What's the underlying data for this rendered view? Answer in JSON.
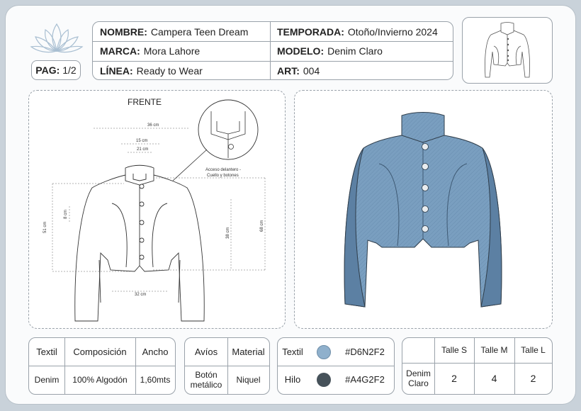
{
  "header": {
    "nombre_label": "NOMBRE:",
    "nombre_value": "Campera Teen Dream",
    "marca_label": "MARCA:",
    "marca_value": "Mora Lahore",
    "linea_label": "LÍNEA:",
    "linea_value": "Ready to Wear",
    "temporada_label": "TEMPORADA:",
    "temporada_value": "Otoño/Invierno 2024",
    "modelo_label": "MODELO:",
    "modelo_value": "Denim Claro",
    "art_label": "ART:",
    "art_value": "004",
    "pag_label": "PAG:",
    "pag_value": "1/2"
  },
  "technical": {
    "title": "FRENTE",
    "dims": {
      "d36": "36 cm",
      "d15": "15 cm",
      "d21": "21 cm",
      "d8": "8 cm",
      "d51": "51 cm",
      "d38": "38 cm",
      "d68": "68 cm",
      "d32": "32 cm"
    },
    "detail_note_1": "Acceso delantero -",
    "detail_note_2": "Cuello y botones"
  },
  "table1": {
    "headers": [
      "Textil",
      "Composición",
      "Ancho"
    ],
    "row": [
      "Denim",
      "100% Algodón",
      "1,60mts"
    ]
  },
  "table2": {
    "headers": [
      "Avíos",
      "Material"
    ],
    "row_name_1": "Botón",
    "row_name_2": "metálico",
    "row_value": "Niquel"
  },
  "table3": {
    "rows": [
      {
        "label": "Textil",
        "code": "#D6N2F2",
        "color": "#8fb0cc"
      },
      {
        "label": "Hilo",
        "code": "#A4G2F2",
        "color": "#46525a"
      }
    ]
  },
  "table4": {
    "headers": [
      "Talle S",
      "Talle M",
      "Talle L"
    ],
    "row_label_1": "Denim",
    "row_label_2": "Claro",
    "values": [
      "2",
      "4",
      "2"
    ]
  },
  "colors": {
    "denim": "#7a9fc0",
    "denim_dark": "#5c80a3",
    "button": "#e8ecef"
  }
}
